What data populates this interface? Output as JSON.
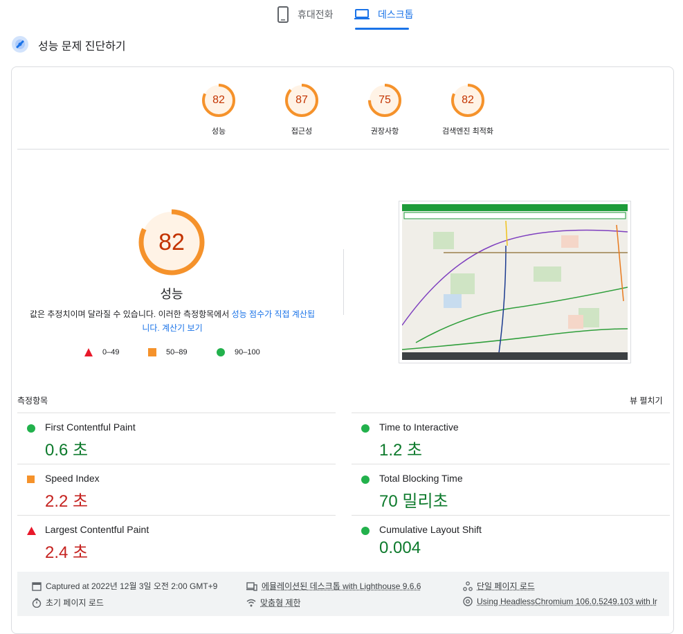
{
  "tabs": [
    {
      "label": "휴대전화",
      "icon": "phone-icon",
      "active": false
    },
    {
      "label": "데스크톱",
      "icon": "laptop-icon",
      "active": true
    }
  ],
  "header": {
    "title": "성능 문제 진단하기",
    "icon": "lighthouse-icon"
  },
  "scores": [
    {
      "value": "82",
      "label": "성능"
    },
    {
      "value": "87",
      "label": "접근성"
    },
    {
      "value": "75",
      "label": "권장사항"
    },
    {
      "value": "82",
      "label": "검색엔진 최적화"
    }
  ],
  "performance": {
    "score": "82",
    "label": "성능",
    "desc_prefix": "값은 추정치이며 달라질 수 있습니다. 이러한 측정항목에서 ",
    "desc_link": "성능 점수가 직접 계산됩니다. 계산기 보기"
  },
  "legend": [
    {
      "range": "0–49",
      "shape": "triangle",
      "color": "#e8182a"
    },
    {
      "range": "50–89",
      "shape": "square",
      "color": "#f5922b"
    },
    {
      "range": "90–100",
      "shape": "circle",
      "color": "#22b14c"
    }
  ],
  "metrics_section": {
    "title": "측정항목",
    "expand_label": "뷰 펼치기"
  },
  "metrics": [
    {
      "name": "First Contentful Paint",
      "value": "0.6 초",
      "status": "good"
    },
    {
      "name": "Time to Interactive",
      "value": "1.2 초",
      "status": "good"
    },
    {
      "name": "Speed Index",
      "value": "2.2 초",
      "status": "average"
    },
    {
      "name": "Total Blocking Time",
      "value": "70 밀리초",
      "status": "good"
    },
    {
      "name": "Largest Contentful Paint",
      "value": "2.4 초",
      "status": "poor"
    },
    {
      "name": "Cumulative Layout Shift",
      "value": "0.004",
      "status": "good"
    }
  ],
  "footer": {
    "captured": "Captured at 2022년 12월 3일 오전 2:00 GMT+9",
    "emulated": "에뮬레이션된 데스크톱 with Lighthouse 9.6.6",
    "single_page": "단일 페이지 로드",
    "initial_load": "초기 페이지 로드",
    "throttling": "맞춤형 제한",
    "browser": "Using HeadlessChromium 106.0.5249.103 with lr"
  },
  "colors": {
    "accent": "#1a73e8",
    "average": "#f5922b",
    "good": "#22b14c",
    "poor": "#e8182a"
  }
}
